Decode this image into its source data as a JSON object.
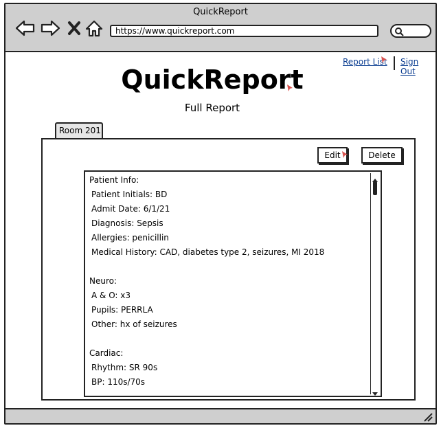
{
  "window": {
    "title": "QuickReport"
  },
  "browser": {
    "url": "https://www.quickreport.com",
    "back_icon": "back-arrow-icon",
    "forward_icon": "forward-arrow-icon",
    "stop_icon": "close-icon",
    "home_icon": "home-icon"
  },
  "header": {
    "links": {
      "report_list": "Report List",
      "sign_out": "Sign Out"
    },
    "app_title": "QuickReport",
    "subtitle": "Full Report"
  },
  "tabs": [
    {
      "label": "Room 201"
    }
  ],
  "actions": {
    "edit": "Edit",
    "delete": "Delete"
  },
  "report": {
    "lines": [
      {
        "text": "Patient Info:",
        "indent": false
      },
      {
        "text": "Patient Initials: BD",
        "indent": true
      },
      {
        "text": "Admit Date: 6/1/21",
        "indent": true
      },
      {
        "text": "Diagnosis: Sepsis",
        "indent": true
      },
      {
        "text": "Allergies: penicillin",
        "indent": true
      },
      {
        "text": "Medical History: CAD, diabetes type 2, seizures, MI 2018",
        "indent": true
      },
      {
        "text": "",
        "indent": false
      },
      {
        "text": "Neuro:",
        "indent": false
      },
      {
        "text": "A & O: x3",
        "indent": true
      },
      {
        "text": "Pupils: PERRLA",
        "indent": true
      },
      {
        "text": "Other: hx of seizures",
        "indent": true
      },
      {
        "text": "",
        "indent": false
      },
      {
        "text": "Cardiac:",
        "indent": false
      },
      {
        "text": "Rhythm: SR 90s",
        "indent": true
      },
      {
        "text": "BP: 110s/70s",
        "indent": true
      }
    ]
  },
  "colors": {
    "link": "#0b3d91",
    "chrome": "#cfcfcf",
    "cursor": "#d9534f"
  }
}
